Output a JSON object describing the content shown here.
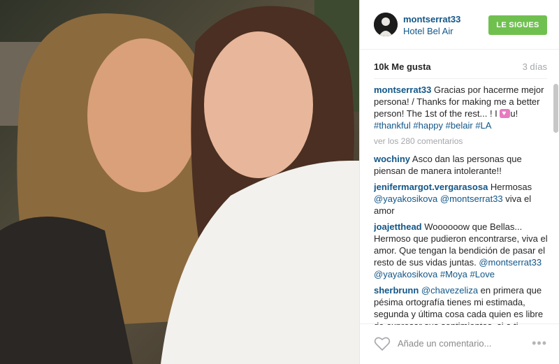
{
  "post": {
    "username": "montserrat33",
    "location": "Hotel Bel Air",
    "follow_label": "LE SIGUES",
    "likes": "10k Me gusta",
    "time_ago": "3 días"
  },
  "caption": {
    "user": "montserrat33",
    "text_1": " Gracias por hacerme mejor persona! / Thanks for making me a better person! The 1st of the rest... ! I ",
    "text_2": "u! ",
    "tags": [
      "#thankful",
      "#happy",
      "#belair",
      "#LA"
    ]
  },
  "view_more": "ver los 280 comentarios",
  "comments": [
    {
      "user": "wochiny",
      "text": " Asco dan las personas que piensan de manera intolerante!!"
    },
    {
      "user": "jenifermargot.vergarasosa",
      "text": " Hermosas ",
      "mentions": [
        "@yayakosikova",
        "@montserrat33"
      ],
      "text_after": " viva el amor"
    },
    {
      "user": "joajetthead",
      "text": " Woooooow que Bellas... Hermoso que pudieron encontrarse, viva el amor. Que tengan la bendición de pasar el resto de sus vidas juntas. ",
      "mentions": [
        "@montserrat33",
        "@yayakosikova"
      ],
      "tags": [
        "#Moya",
        "#Love"
      ]
    },
    {
      "user": "sherbrunn",
      "mention": "@chavezeliza",
      "text": " en primera que pésima ortografía tienes mi estimada, segunda y última cosa cada quien es libre de expresar sus sentimientos, si a ti"
    }
  ],
  "footer": {
    "add_comment_placeholder": "Añade un comentario...",
    "more_icon": "•••"
  },
  "colors": {
    "link": "#125688",
    "follow_bg": "#70c050",
    "muted": "#a5a7aa"
  },
  "icons": [
    "heart-icon",
    "more-options-icon",
    "avatar"
  ]
}
